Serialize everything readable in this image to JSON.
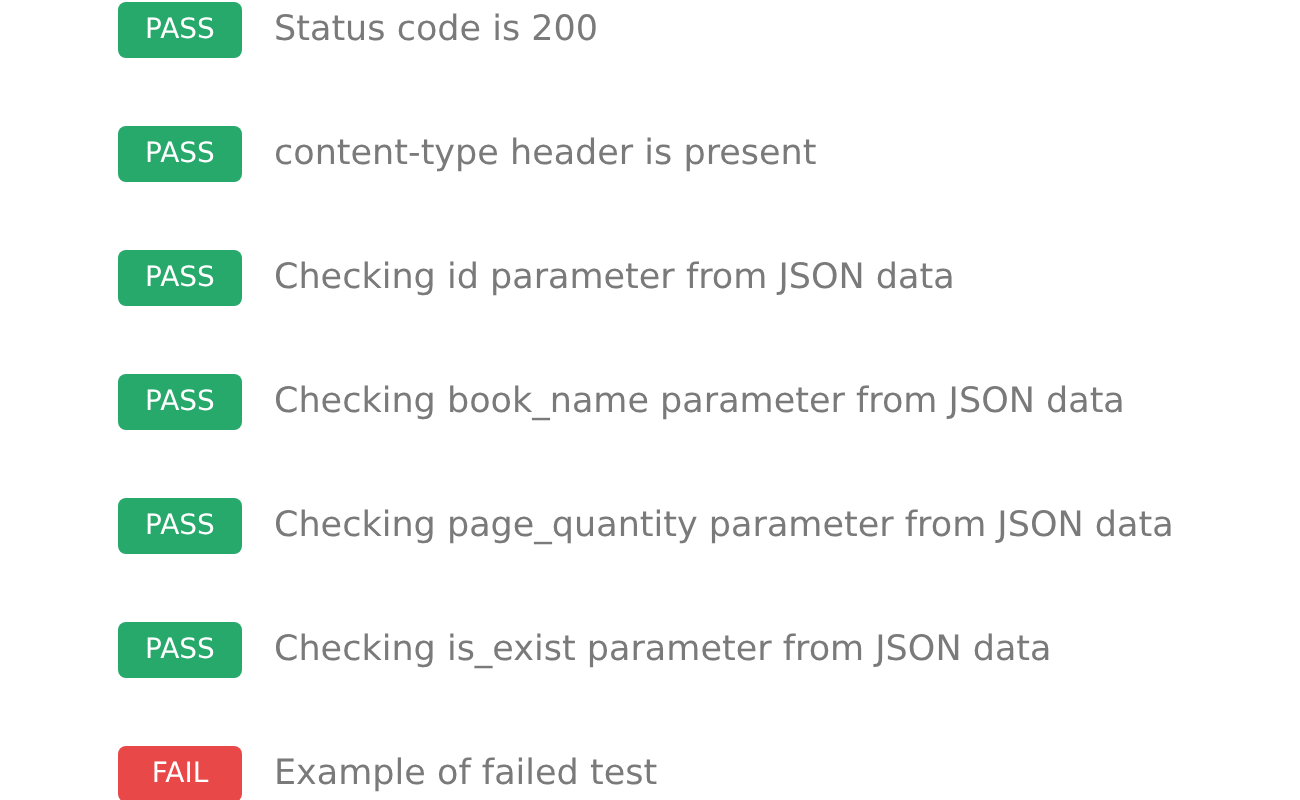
{
  "tests": [
    {
      "kind": "pass",
      "badge": "PASS",
      "name": "Status code is 200"
    },
    {
      "kind": "pass",
      "badge": "PASS",
      "name": "content-type header is present"
    },
    {
      "kind": "pass",
      "badge": "PASS",
      "name": "Checking id parameter from JSON data"
    },
    {
      "kind": "pass",
      "badge": "PASS",
      "name": "Checking book_name parameter from JSON data"
    },
    {
      "kind": "pass",
      "badge": "PASS",
      "name": "Checking page_quantity parameter from JSON data"
    },
    {
      "kind": "pass",
      "badge": "PASS",
      "name": "Checking is_exist parameter from JSON data"
    },
    {
      "kind": "fail",
      "badge": "FAIL",
      "name": "Example of failed test"
    }
  ]
}
